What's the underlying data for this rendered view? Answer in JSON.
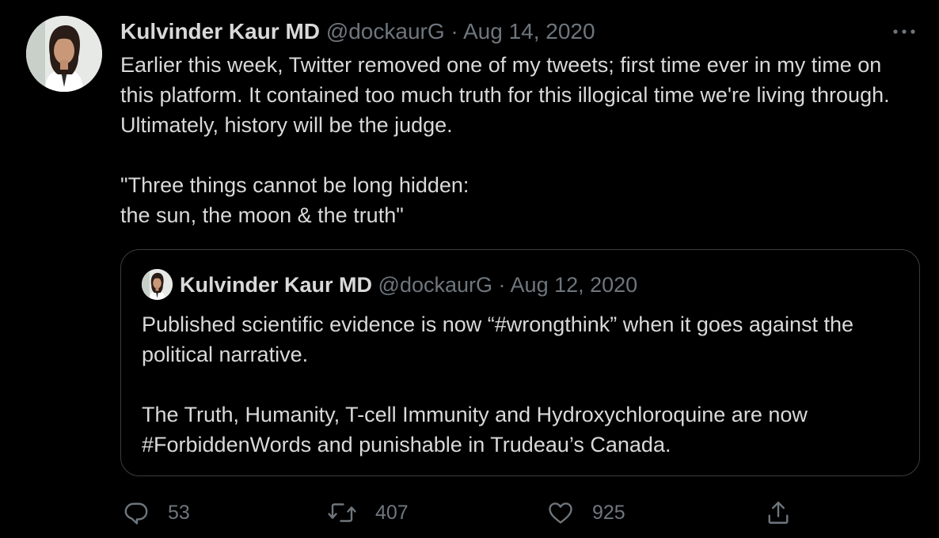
{
  "tweet": {
    "author_name": "Kulvinder Kaur MD",
    "handle": "@dockaurG",
    "separator": "·",
    "date": "Aug 14, 2020",
    "text": "Earlier this week, Twitter removed one of my tweets; first time ever in my time on this platform. It contained too much truth for this illogical time we're living through. Ultimately, history will be the judge.\n\n\"Three things cannot be long hidden:\nthe sun, the moon & the truth\"",
    "more_icon": "more-horizontal-icon"
  },
  "quoted_tweet": {
    "author_name": "Kulvinder Kaur MD",
    "handle": "@dockaurG",
    "separator": "·",
    "date": "Aug 12, 2020",
    "text": "Published scientific evidence is now “#wrongthink” when it goes against the political narrative.\n\nThe Truth, Humanity, T-cell Immunity and Hydroxychloroquine are now #ForbiddenWords and punishable in Trudeau’s Canada."
  },
  "actions": {
    "reply": {
      "icon": "reply-icon",
      "count": "53"
    },
    "retweet": {
      "icon": "retweet-icon",
      "count": "407"
    },
    "like": {
      "icon": "heart-icon",
      "count": "925"
    },
    "share": {
      "icon": "share-icon"
    }
  },
  "colors": {
    "background": "#000000",
    "primary_text": "#d9d9d9",
    "secondary_text": "#6e767d",
    "border": "#3a3d40"
  }
}
